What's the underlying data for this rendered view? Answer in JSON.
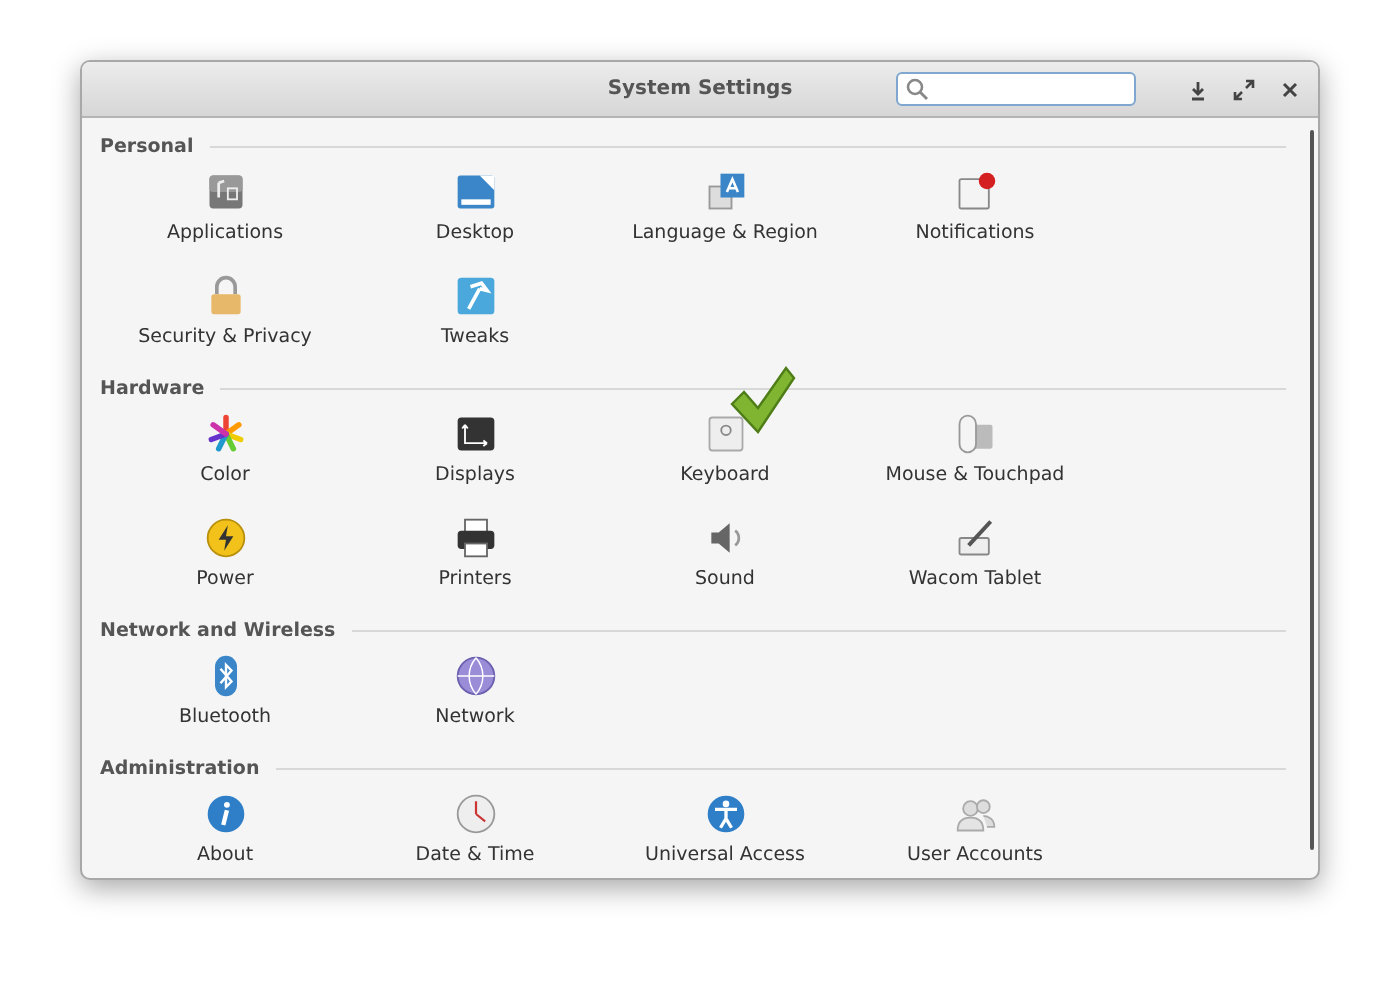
{
  "window": {
    "title": "System Settings"
  },
  "sections": [
    {
      "title": "Personal",
      "items": [
        {
          "label": "Applications",
          "marked": false
        },
        {
          "label": "Desktop",
          "marked": false
        },
        {
          "label": "Language & Region",
          "marked": false
        },
        {
          "label": "Notifications",
          "marked": false
        },
        {
          "label": "Security & Privacy",
          "marked": false
        },
        {
          "label": "Tweaks",
          "marked": false
        }
      ]
    },
    {
      "title": "Hardware",
      "items": [
        {
          "label": "Color",
          "marked": false
        },
        {
          "label": "Displays",
          "marked": false
        },
        {
          "label": "Keyboard",
          "marked": true
        },
        {
          "label": "Mouse & Touchpad",
          "marked": false
        },
        {
          "label": "Power",
          "marked": false
        },
        {
          "label": "Printers",
          "marked": false
        },
        {
          "label": "Sound",
          "marked": false
        },
        {
          "label": "Wacom Tablet",
          "marked": false
        }
      ]
    },
    {
      "title": "Network and Wireless",
      "items": [
        {
          "label": "Bluetooth",
          "marked": false
        },
        {
          "label": "Network",
          "marked": false
        }
      ]
    },
    {
      "title": "Administration",
      "items": [
        {
          "label": "About",
          "marked": false
        },
        {
          "label": "Date & Time",
          "marked": false
        },
        {
          "label": "Universal Access",
          "marked": false
        },
        {
          "label": "User Accounts",
          "marked": false
        }
      ]
    }
  ]
}
